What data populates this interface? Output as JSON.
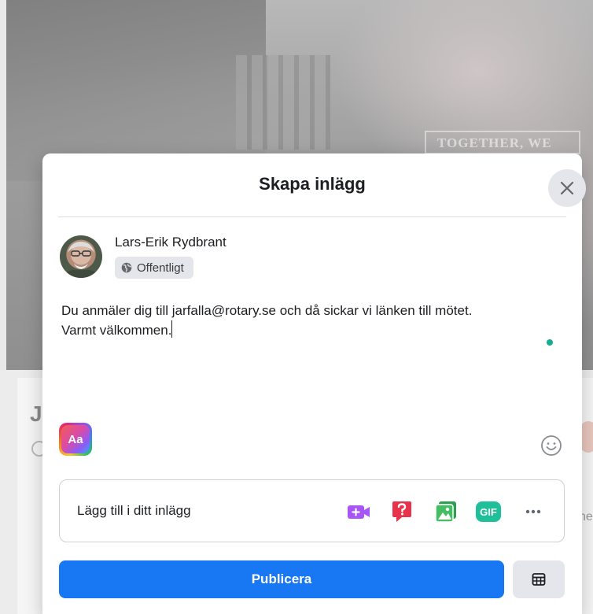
{
  "background": {
    "sign_text": "TOGETHER, WE",
    "card_letter": "J",
    "side_text": "ne"
  },
  "modal": {
    "title": "Skapa inlägg",
    "close_icon": "close-icon",
    "user": {
      "name": "Lars-Erik Rydbrant",
      "privacy_label": "Offentligt",
      "privacy_icon": "globe-icon"
    },
    "post": {
      "line1": "Du anmäler dig till jarfalla@rotary.se och då sickar vi länken till mötet.",
      "line2": "Varmt välkommen."
    },
    "text_format_label": "Aa",
    "add_to_post": {
      "label": "Lägg till i ditt inlägg",
      "tools": [
        {
          "icon": "live-video-icon",
          "color": "#a855f7"
        },
        {
          "icon": "question-icon",
          "color": "#e8314b"
        },
        {
          "icon": "photo-icon",
          "color": "#45bd62"
        },
        {
          "icon": "gif-icon",
          "label": "GIF",
          "color": "#1fbf9a"
        },
        {
          "icon": "more-icon"
        }
      ]
    },
    "publish_label": "Publicera",
    "schedule_icon": "calendar-icon",
    "accent_color": "#1877f2"
  }
}
